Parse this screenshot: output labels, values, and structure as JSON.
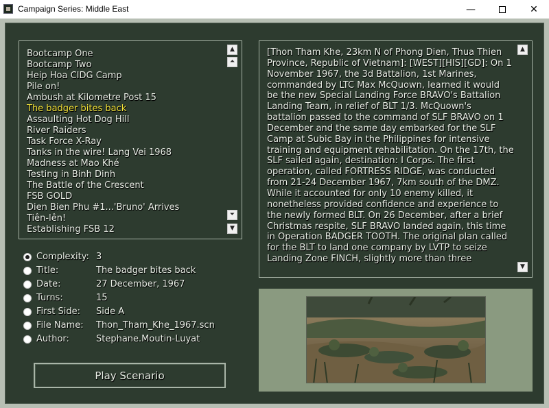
{
  "window": {
    "title": "Campaign Series: Middle East",
    "minimize_glyph": "—",
    "close_glyph": "✕"
  },
  "scenarios": {
    "items": [
      "Bootcamp One",
      "Bootcamp Two",
      "Heip Hoa CIDG Camp",
      "Pile on!",
      "Ambush at Kilometre Post 15",
      "The badger bites back",
      "Assaulting Hot Dog Hill",
      "River Raiders",
      "Task Force X-Ray",
      "Tanks in the wire! Lang Vei 1968",
      "Madness at Mao Khé",
      "Testing in Binh Dinh",
      "The Battle of the Crescent",
      "FSB GOLD",
      "Dien Bien Phu #1...'Bruno' Arrives",
      "Tiên-lên!",
      "Establishing FSB 12"
    ],
    "selected_index": 5,
    "scroll_up": "▲",
    "scroll_page_up": "⏶",
    "scroll_page_down": "⏷",
    "scroll_down": "▼"
  },
  "info": {
    "complexity_label": "Complexity:",
    "complexity_value": "3",
    "title_label": "Title:",
    "title_value": "The badger bites back",
    "date_label": "Date:",
    "date_value": "27 December, 1967",
    "turns_label": "Turns:",
    "turns_value": "15",
    "first_side_label": "First Side:",
    "first_side_value": "Side A",
    "file_name_label": "File Name:",
    "file_name_value": "Thon_Tham_Khe_1967.scn",
    "author_label": "Author:",
    "author_value": "Stephane.Moutin-Luyat"
  },
  "play_button": "Play Scenario",
  "description": {
    "lines": [
      "[Thon Tham Khe, 23km N of Phong Dien, Thua Thien",
      "Province, Republic of Vietnam]: [WEST][HIS][GD]: On 1",
      "November 1967, the 3d Battalion, 1st Marines,",
      "commanded by LTC Max McQuown, learned it would",
      "be the new Special Landing Force BRAVO's Battalion",
      "Landing Team, in relief of BLT 1/3. McQuown's",
      "battalion passed to the command of SLF BRAVO on 1",
      "December and the same day embarked for the SLF",
      "Camp at Subic Bay in the Philippines for intensive",
      "training and equipment rehabilitation. On the 17th, the",
      "SLF sailed again, destination: I Corps. The first",
      "operation, called FORTRESS RIDGE, was conducted",
      "from 21-24 December 1967, 7km south of the DMZ.",
      "While it accounted for only 10 enemy killed, it",
      "nonetheless provided confidence and experience to",
      "the newly formed BLT. On 26 December, after a brief",
      "Christmas respite, SLF BRAVO landed again, this time",
      "in Operation BADGER TOOTH. The original plan called",
      "for the BLT to land one company by LVTP to seize",
      "Landing Zone FINCH, slightly more than three"
    ]
  },
  "colors": {
    "panel": "#2d3b2f",
    "border": "#a9b5a8",
    "selected_text": "#f2e23a",
    "text": "#e9efe6",
    "photo_frame": "#8a9a80"
  }
}
